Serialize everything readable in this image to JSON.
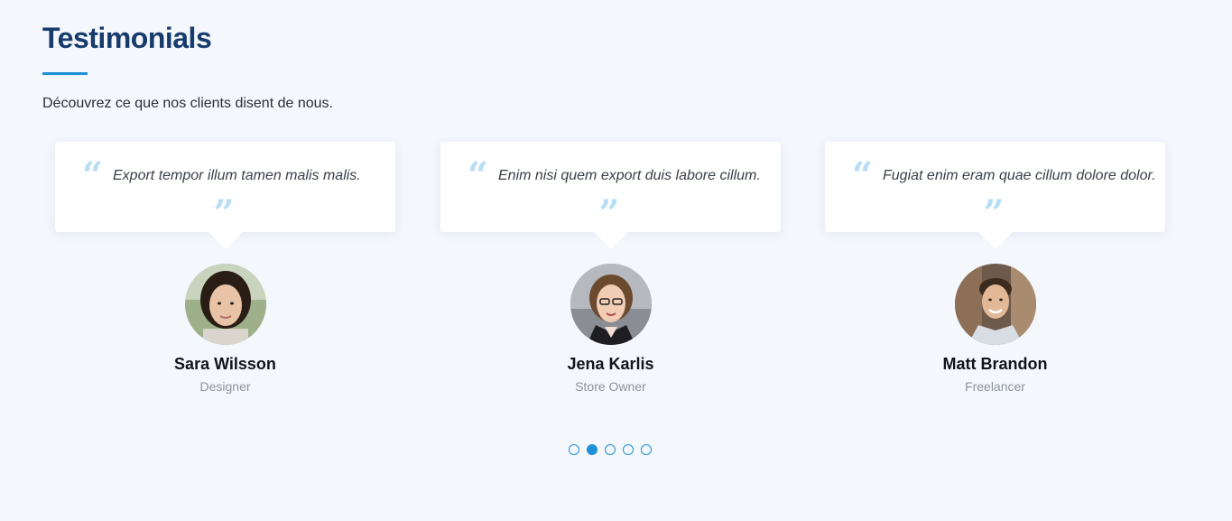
{
  "header": {
    "title": "Testimonials",
    "subtitle": "Découvrez ce que nos clients disent de nous."
  },
  "quote_marks": {
    "open": "“",
    "close": "”"
  },
  "testimonials": [
    {
      "quote": "Export tempor illum tamen malis malis.",
      "name": "Sara Wilsson",
      "role": "Designer"
    },
    {
      "quote": "Enim nisi quem export duis labore cillum.",
      "name": "Jena Karlis",
      "role": "Store Owner"
    },
    {
      "quote": "Fugiat enim eram quae cillum dolore dolor.",
      "name": "Matt Brandon",
      "role": "Freelancer"
    }
  ],
  "pagination": {
    "total": 5,
    "active": 2
  },
  "colors": {
    "title": "#173b6c",
    "accent": "#1e90d6",
    "quote_icon": "#b7def5",
    "background": "#f4f7fc"
  }
}
